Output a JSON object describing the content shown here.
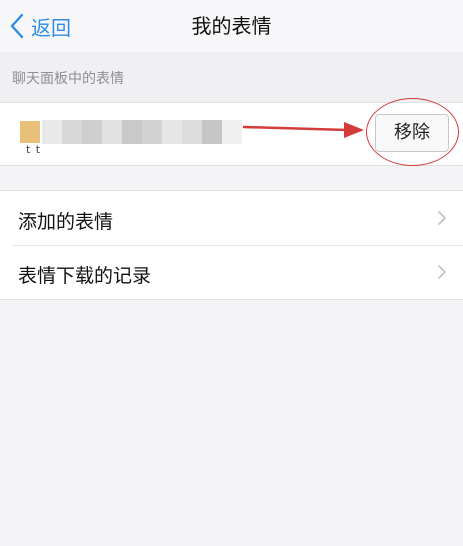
{
  "navbar": {
    "back_label": "返回",
    "title": "我的表情"
  },
  "section": {
    "header": "聊天面板中的表情"
  },
  "emoji_row": {
    "remove_label": "移除",
    "thumb_color": "#e8c07a",
    "thumb_glyph": "t t"
  },
  "menu": {
    "items": [
      {
        "label": "添加的表情"
      },
      {
        "label": "表情下载的记录"
      }
    ]
  },
  "colors": {
    "accent": "#2e8ee6",
    "annotation_red": "#d43b3b",
    "background": "#f4f4f6"
  }
}
